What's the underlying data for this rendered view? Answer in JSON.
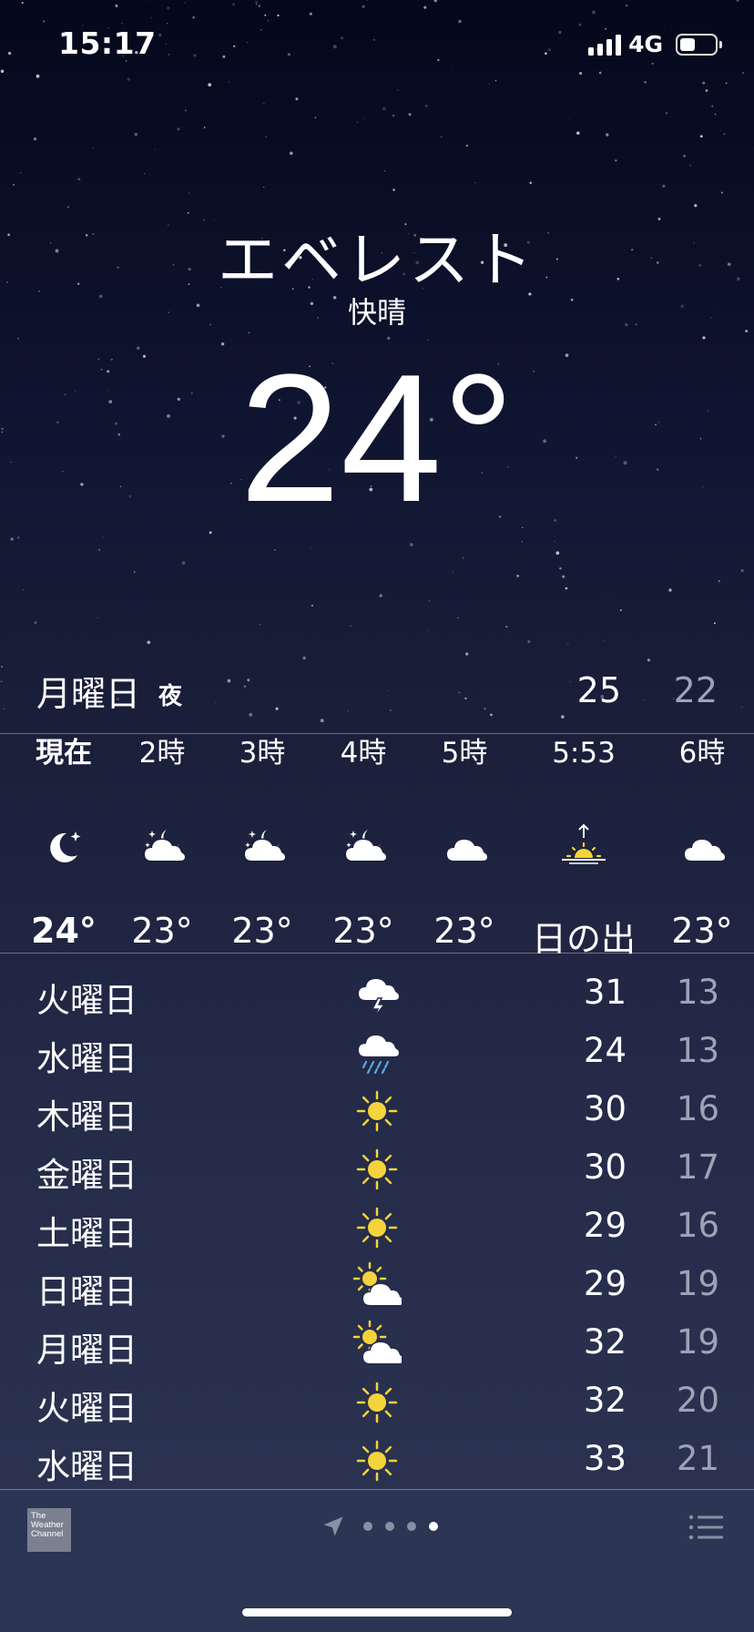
{
  "status_bar": {
    "time": "15:17",
    "network": "4G",
    "battery_level": 0.45,
    "signal_bars": 4
  },
  "location": {
    "city": "エベレスト",
    "condition": "快晴",
    "temperature": "24°"
  },
  "today": {
    "day": "月曜日",
    "tag": "夜",
    "high": "25",
    "low": "22"
  },
  "hourly": [
    {
      "time": "現在",
      "icon": "moon-stars-icon",
      "temp": "24°"
    },
    {
      "time": "2時",
      "icon": "partly-cloudy-night-icon",
      "temp": "23°"
    },
    {
      "time": "3時",
      "icon": "partly-cloudy-night-icon",
      "temp": "23°"
    },
    {
      "time": "4時",
      "icon": "partly-cloudy-night-icon",
      "temp": "23°"
    },
    {
      "time": "5時",
      "icon": "cloud-icon",
      "temp": "23°"
    },
    {
      "time": "5:53",
      "icon": "sunrise-icon",
      "temp": "日の出"
    },
    {
      "time": "6時",
      "icon": "cloud-icon",
      "temp": "23°"
    }
  ],
  "daily": [
    {
      "day": "火曜日",
      "icon": "thunderstorm-icon",
      "high": "31",
      "low": "13"
    },
    {
      "day": "水曜日",
      "icon": "rain-icon",
      "high": "24",
      "low": "13"
    },
    {
      "day": "木曜日",
      "icon": "sun-icon",
      "high": "30",
      "low": "16"
    },
    {
      "day": "金曜日",
      "icon": "sun-icon",
      "high": "30",
      "low": "17"
    },
    {
      "day": "土曜日",
      "icon": "sun-icon",
      "high": "29",
      "low": "16"
    },
    {
      "day": "日曜日",
      "icon": "partly-sunny-icon",
      "high": "29",
      "low": "19"
    },
    {
      "day": "月曜日",
      "icon": "partly-sunny-icon",
      "high": "32",
      "low": "19"
    },
    {
      "day": "火曜日",
      "icon": "sun-icon",
      "high": "32",
      "low": "20"
    },
    {
      "day": "水曜日",
      "icon": "sun-icon",
      "high": "33",
      "low": "21"
    }
  ],
  "footer": {
    "provider_logo": [
      "The",
      "Weather",
      "Channel"
    ],
    "page_count": 4,
    "active_page": 4,
    "icons": [
      "location-arrow-icon",
      "list-icon"
    ]
  },
  "colors": {
    "sun": "#f5d33c",
    "rain": "#5aa8e6",
    "low_temp": "#9ea2b4"
  }
}
